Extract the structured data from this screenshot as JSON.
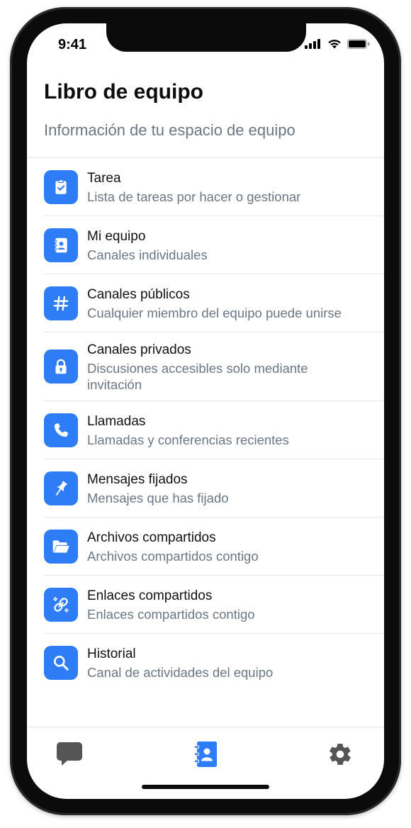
{
  "status_bar": {
    "time": "9:41"
  },
  "header": {
    "title": "Libro de equipo",
    "subtitle": "Información de tu espacio de equipo"
  },
  "items": [
    {
      "label": "Tarea",
      "description": "Lista de tareas por hacer o gestionar",
      "icon": "clipboard-check-icon"
    },
    {
      "label": "Mi equipo",
      "description": "Canales individuales",
      "icon": "contact-book-icon"
    },
    {
      "label": "Canales públicos",
      "description": "Cualquier miembro del equipo puede unirse",
      "icon": "hash-icon"
    },
    {
      "label": "Canales privados",
      "description_line1": "Discusiones accesibles solo mediante",
      "description_line2": "invitación",
      "icon": "lock-icon"
    },
    {
      "label": "Llamadas",
      "description": "Llamadas y conferencias recientes",
      "icon": "phone-icon"
    },
    {
      "label": "Mensajes fijados",
      "description": "Mensajes que has fijado",
      "icon": "pin-icon"
    },
    {
      "label": "Archivos compartidos",
      "description": "Archivos compartidos contigo",
      "icon": "folder-open-icon"
    },
    {
      "label": "Enlaces compartidos",
      "description": "Enlaces compartidos contigo",
      "icon": "link-icon"
    },
    {
      "label": "Historial",
      "description": "Canal de actividades del equipo",
      "icon": "search-icon"
    }
  ],
  "tab_bar": {
    "tabs": [
      {
        "icon": "chat-icon",
        "active": false
      },
      {
        "icon": "contact-book-icon",
        "active": true
      },
      {
        "icon": "gear-icon",
        "active": false
      }
    ],
    "active_color": "#2f7df6",
    "inactive_color": "#555555"
  },
  "colors": {
    "accent": "#2f7df6",
    "secondary_text": "#6b7785",
    "divider": "#e3e6ea"
  }
}
